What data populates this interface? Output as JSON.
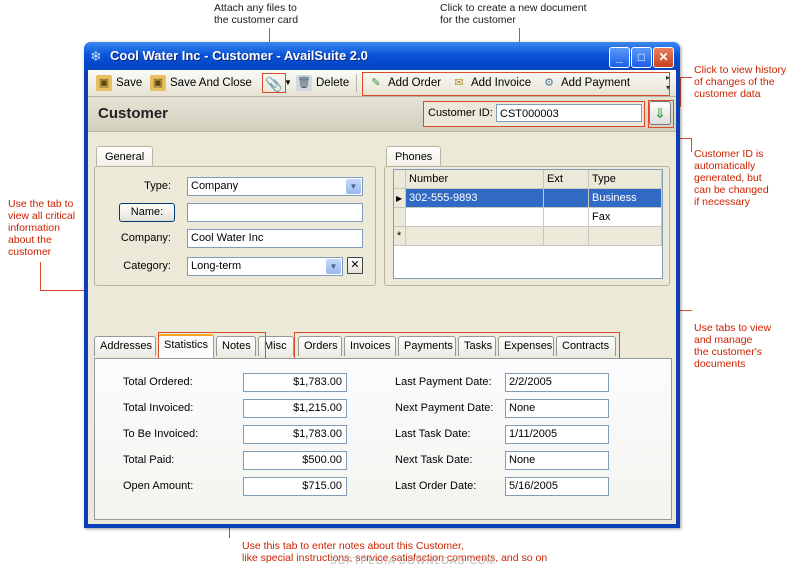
{
  "annotations": {
    "attach": "Attach any files to\nthe customer card",
    "create_doc": "Click to create a new document\nfor the customer",
    "history": "Click to view history\nof changes of the\ncustomer data",
    "customer_id": "Customer ID is\nautomatically\ngenerated, but\ncan be changed\nif necessary",
    "tab_stats": "Use the tab to\nview all critical\ninformation\nabout the\ncustomer",
    "tabs_docs": "Use tabs to view\nand manage\nthe customer's\ndocuments",
    "notes": "Use this tab to enter notes about this Customer,\nlike special instructions, service satisfaction comments, and so on"
  },
  "window": {
    "title": "Cool Water Inc - Customer - AvailSuite 2.0"
  },
  "toolbar": {
    "save": "Save",
    "save_close": "Save And Close",
    "delete": "Delete",
    "add_order": "Add Order",
    "add_invoice": "Add Invoice",
    "add_payment": "Add Payment"
  },
  "header": {
    "title": "Customer",
    "customer_id_label": "Customer ID:",
    "customer_id": "CST000003"
  },
  "general": {
    "tab": "General",
    "type_label": "Type:",
    "type_value": "Company",
    "name_button": "Name:",
    "name_value": "",
    "company_label": "Company:",
    "company_value": "Cool Water Inc",
    "category_label": "Category:",
    "category_value": "Long-term"
  },
  "phones": {
    "tab": "Phones",
    "columns": [
      "Number",
      "Ext",
      "Type"
    ],
    "rows": [
      {
        "number": "302-555-9893",
        "ext": "",
        "type": "Business"
      },
      {
        "number": "",
        "ext": "",
        "type": "Fax"
      }
    ],
    "new_row_marker": "*"
  },
  "tabs": [
    "Addresses",
    "Statistics",
    "Notes",
    "Misc",
    "Orders",
    "Invoices",
    "Payments",
    "Tasks",
    "Expenses",
    "Contracts"
  ],
  "active_tab": "Statistics",
  "stats": {
    "left": [
      {
        "label": "Total Ordered:",
        "value": "$1,783.00"
      },
      {
        "label": "Total Invoiced:",
        "value": "$1,215.00"
      },
      {
        "label": "To Be Invoiced:",
        "value": "$1,783.00"
      },
      {
        "label": "Total Paid:",
        "value": "$500.00"
      },
      {
        "label": "Open Amount:",
        "value": "$715.00"
      }
    ],
    "right": [
      {
        "label": "Last Payment Date:",
        "value": "2/2/2005"
      },
      {
        "label": "Next Payment Date:",
        "value": "None"
      },
      {
        "label": "Last Task Date:",
        "value": "1/11/2005"
      },
      {
        "label": "Next Task Date:",
        "value": "None"
      },
      {
        "label": "Last Order Date:",
        "value": "5/16/2005"
      }
    ]
  },
  "watermark": "SOFTPEDIA DOWNLOAD.COM"
}
